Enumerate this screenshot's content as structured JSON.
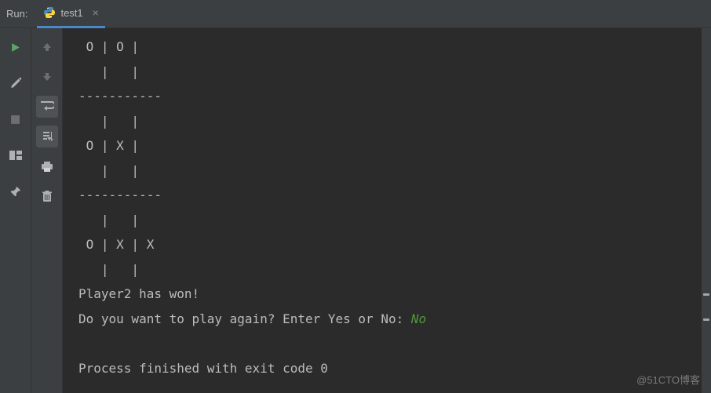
{
  "header": {
    "label": "Run:",
    "tab": {
      "title": "test1",
      "close": "×"
    }
  },
  "gutter1": {
    "run": "run-icon",
    "wrench": "wrench-icon",
    "stop": "stop-icon",
    "layout": "layout-icon",
    "pin": "pin-icon"
  },
  "gutter2": {
    "up": "up-icon",
    "down": "down-icon",
    "wrap": "wrap-icon",
    "export": "scroll-to-end-icon",
    "print": "print-icon",
    "trash": "trash-icon"
  },
  "console": {
    "lines": [
      " O | O |",
      "   |   |",
      "-----------",
      "   |   |",
      " O | X |",
      "   |   |",
      "-----------",
      "   |   |",
      " O | X | X",
      "   |   |",
      "Player2 has won!"
    ],
    "prompt": "Do you want to play again? Enter Yes or No: ",
    "user_input": "No",
    "exit": "Process finished with exit code 0"
  },
  "watermark": "@51CTO博客"
}
